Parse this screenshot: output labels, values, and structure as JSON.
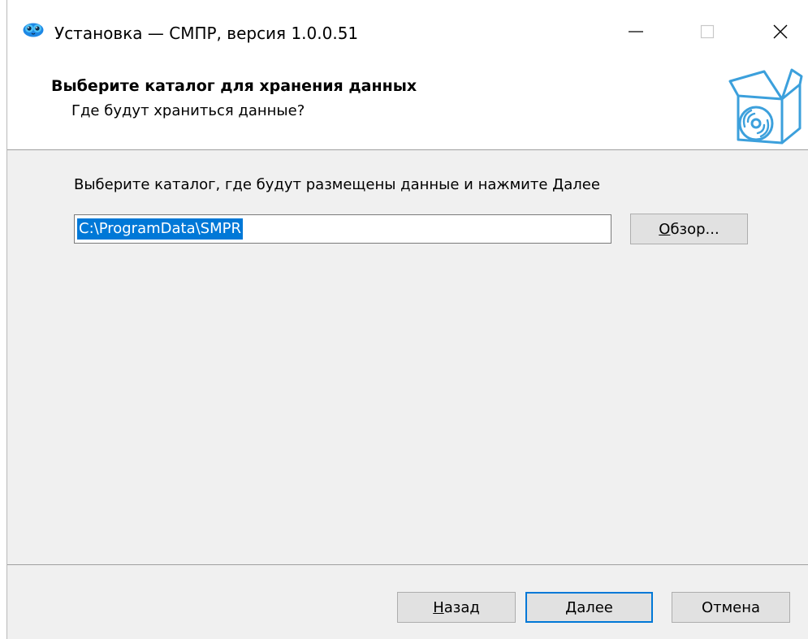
{
  "window": {
    "title": "Установка — СМПР, версия 1.0.0.51",
    "icon": "owl-app-icon",
    "controls": [
      "minimize-icon",
      "maximize-icon",
      "close-icon"
    ]
  },
  "header": {
    "title": "Выберите каталог для хранения данных",
    "subtitle": "Где будут храниться данные?",
    "icon": "box-disc-icon"
  },
  "content": {
    "instruction": "Выберите каталог, где будут размещены данные и нажмите Далее",
    "path_value": "C:\\ProgramData\\SMPR",
    "browse_label_mnemonic": "О",
    "browse_label_rest": "бзор..."
  },
  "footer": {
    "back_mnemonic": "Н",
    "back_rest": "азад",
    "next_mnemonic": "Д",
    "next_rest": "алее",
    "cancel_label": "Отмена"
  },
  "colors": {
    "selection": "#0078d7",
    "focus_border": "#0078d7",
    "dialog_bg": "#f0f0f0"
  }
}
